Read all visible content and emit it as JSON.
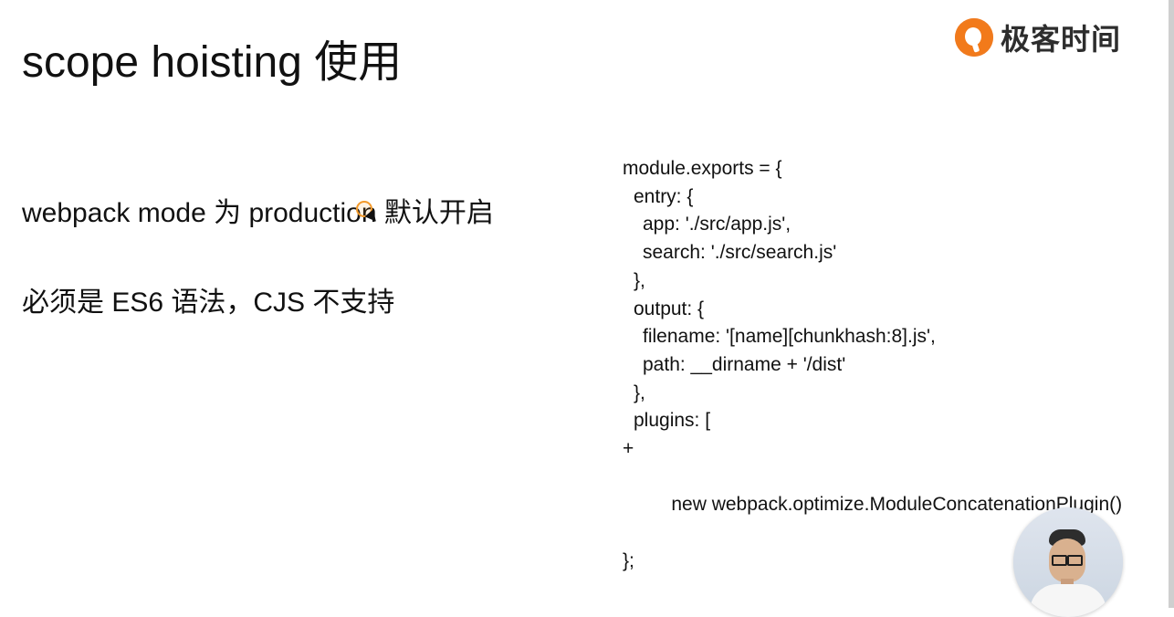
{
  "slide": {
    "title": "scope hoisting 使用",
    "brand": {
      "name": "极客时间",
      "logo_icon": "geektime-logo-icon"
    },
    "points": [
      "webpack mode 为 production 默认开启",
      "必须是 ES6 语法，CJS 不支持"
    ],
    "code": {
      "lines": [
        "module.exports = {",
        "entry: {",
        "app: './src/app.js',",
        "search: './src/search.js'",
        "},",
        "output: {",
        "filename: '[name][chunkhash:8].js',",
        "path: __dirname + '/dist'",
        "},",
        "plugins: [",
        "new webpack.optimize.ModuleConcatenationPlugin()",
        "};"
      ],
      "plus_marker": "+"
    }
  },
  "colors": {
    "accent": "#f27a1a",
    "text": "#111111"
  }
}
